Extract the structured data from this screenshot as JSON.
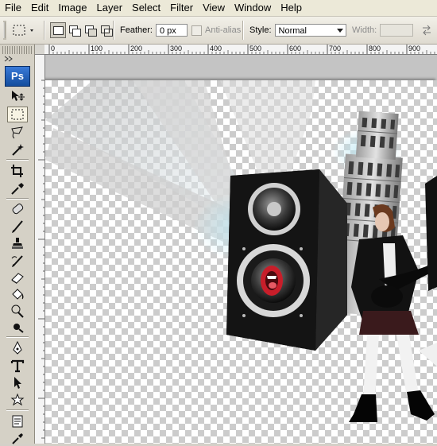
{
  "menu": [
    "File",
    "Edit",
    "Image",
    "Layer",
    "Select",
    "Filter",
    "View",
    "Window",
    "Help"
  ],
  "options": {
    "feather_label": "Feather:",
    "feather_value": "0 px",
    "antialias_label": "Anti-alias",
    "style_label": "Style:",
    "style_value": "Normal",
    "width_label": "Width:"
  },
  "toolbox": {
    "logo": "Ps"
  },
  "ruler": {
    "ticks": [
      "0",
      "100",
      "200",
      "300",
      "400",
      "500",
      "600",
      "700",
      "800",
      "900"
    ]
  },
  "colors": {
    "menubar": "#ece9d8",
    "canvas_bg": "#c4c4c4",
    "accent": "#134d9e",
    "speaker_red": "#c81e2a"
  }
}
